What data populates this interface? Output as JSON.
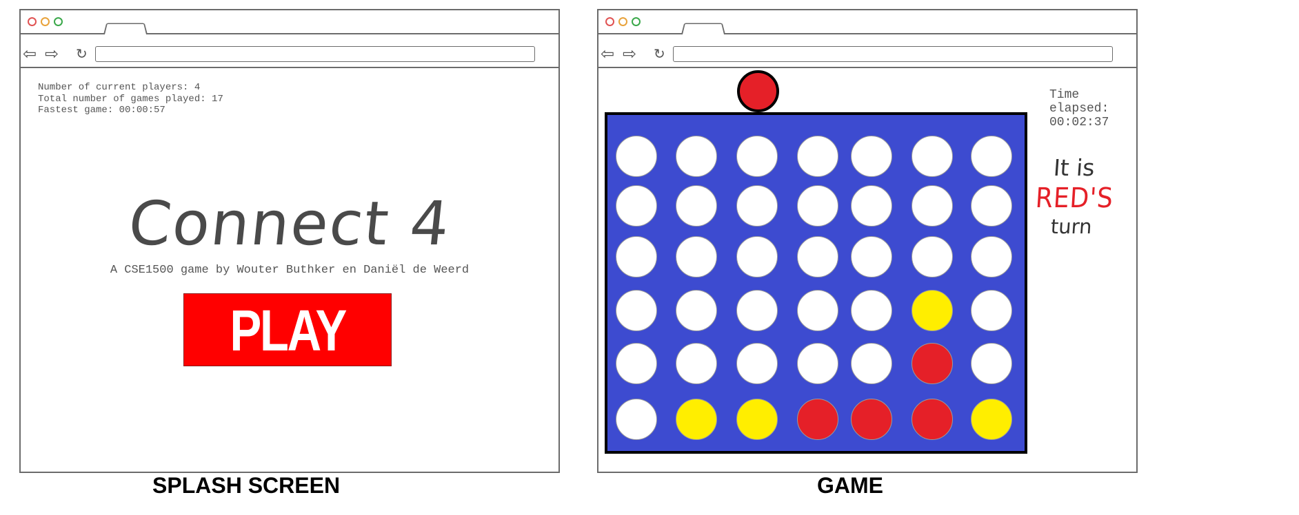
{
  "splash": {
    "stats": {
      "players": "Number of current players: 4",
      "games": "Total number of games played: 17",
      "fastest": "Fastest game: 00:00:57"
    },
    "title": "Connect 4",
    "subtitle": "A CSE1500 game by Wouter Buthker en Daniël de Weerd",
    "play_label": "PLAY",
    "caption": "SPLASH SCREEN"
  },
  "game": {
    "timer_label_1": "Time",
    "timer_label_2": "elapsed:",
    "timer_value": "00:02:37",
    "turn_line_1": "It is",
    "turn_player": "RED'S",
    "turn_line_3": "turn",
    "caption": "GAME",
    "current_piece": "red",
    "board": [
      [
        "empty",
        "empty",
        "empty",
        "empty",
        "empty",
        "empty",
        "empty"
      ],
      [
        "empty",
        "empty",
        "empty",
        "empty",
        "empty",
        "empty",
        "empty"
      ],
      [
        "empty",
        "empty",
        "empty",
        "empty",
        "empty",
        "empty",
        "empty"
      ],
      [
        "empty",
        "empty",
        "empty",
        "empty",
        "empty",
        "yellow",
        "empty"
      ],
      [
        "empty",
        "empty",
        "empty",
        "empty",
        "empty",
        "red",
        "empty"
      ],
      [
        "empty",
        "yellow",
        "yellow",
        "red",
        "red",
        "red",
        "yellow"
      ]
    ]
  },
  "browser": {
    "icons": [
      "back-arrow-icon",
      "forward-arrow-icon",
      "refresh-icon"
    ]
  },
  "colors": {
    "board": "#3d4bd0",
    "red_piece": "#e52028",
    "yellow_piece": "#ffee00",
    "play_button": "#ff0000"
  }
}
